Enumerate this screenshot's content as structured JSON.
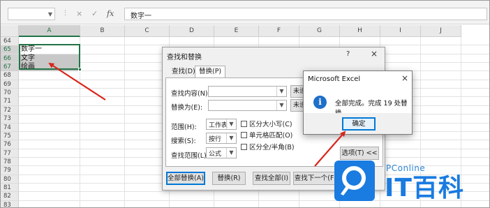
{
  "formula_bar": {
    "name_box": "",
    "cancel_icon": "×",
    "enter_icon": "✓",
    "fx_label": "fx",
    "value": "数字一"
  },
  "sheet": {
    "columns": [
      "A",
      "B",
      "C",
      "D",
      "E",
      "F",
      "G",
      "H",
      "I",
      "J"
    ],
    "rows": [
      "64",
      "65",
      "66",
      "67",
      "68",
      "69",
      "70",
      "71",
      "72",
      "73",
      "74",
      "75",
      "76",
      "77",
      "78",
      "79",
      "80",
      "81",
      "82",
      "83"
    ],
    "cells": {
      "a65": "数字一",
      "a66": "文字",
      "a67": "绘画"
    }
  },
  "find_replace": {
    "title": "查找和替换",
    "help": "?",
    "close": "×",
    "tabs": [
      "查找(D)",
      "替换(P)"
    ],
    "find_label": "查找内容(N):",
    "replace_label": "替换为(E):",
    "find_format": "未设",
    "replace_format": "未设",
    "scope_label": "范围(H):",
    "scope_value": "工作表",
    "search_label": "搜索(S):",
    "search_value": "按行",
    "lookin_label": "查找范围(L):",
    "lookin_value": "公式",
    "match_case": "区分大小写(C)",
    "match_cell": "单元格匹配(O)",
    "match_width": "区分全/半角(B)",
    "options_btn": "选项(T) <<",
    "replace_all": "全部替换(A)",
    "replace": "替换(R)",
    "find_all": "查找全部(I)",
    "find_next": "查找下一个(F)"
  },
  "message_box": {
    "title": "Microsoft Excel",
    "close": "×",
    "text": "全部完成。完成 19 处替换。",
    "ok": "确定"
  },
  "watermark": {
    "brand": "PConline",
    "name": "IT百科"
  },
  "colors": {
    "excel_green": "#217346",
    "dialog_accent": "#0078d7",
    "annotation_red": "#d9251c",
    "logo_blue": "#1a7be0"
  }
}
